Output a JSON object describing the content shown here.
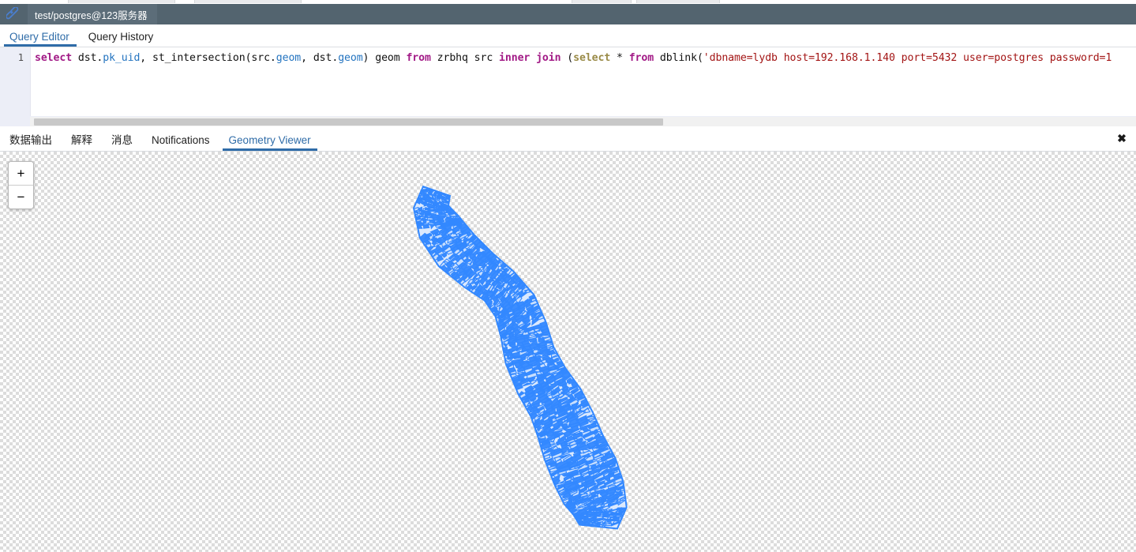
{
  "window": {
    "connection_icon": "link-icon",
    "connection_title": "test/postgres@123服务器"
  },
  "editor_tabs": [
    {
      "label": "Query Editor",
      "active": true
    },
    {
      "label": "Query History",
      "active": false
    }
  ],
  "editor": {
    "line_number": "1",
    "query_tokens": [
      {
        "t": "select",
        "c": "kw"
      },
      {
        "t": " dst.",
        "c": "plain"
      },
      {
        "t": "pk_uid",
        "c": "col"
      },
      {
        "t": ", st_intersection(src.",
        "c": "plain"
      },
      {
        "t": "geom",
        "c": "col"
      },
      {
        "t": ", dst.",
        "c": "plain"
      },
      {
        "t": "geom",
        "c": "col"
      },
      {
        "t": ") geom ",
        "c": "plain"
      },
      {
        "t": "from",
        "c": "kw"
      },
      {
        "t": " zrbhq src ",
        "c": "plain"
      },
      {
        "t": "inner join",
        "c": "kw"
      },
      {
        "t": " (",
        "c": "plain"
      },
      {
        "t": "select",
        "c": "kw2"
      },
      {
        "t": " * ",
        "c": "plain"
      },
      {
        "t": "from",
        "c": "kw"
      },
      {
        "t": " dblink(",
        "c": "plain"
      },
      {
        "t": "'dbname=lydb host=192.168.1.140 port=5432 user=postgres password=1",
        "c": "str"
      }
    ],
    "query_text": "select dst.pk_uid, st_intersection(src.geom, dst.geom) geom from zrbhq src inner join (select * from dblink('dbname=lydb host=192.168.1.140 port=5432 user=postgres password=1"
  },
  "output_tabs": [
    {
      "label": "数据输出",
      "active": false
    },
    {
      "label": "解释",
      "active": false
    },
    {
      "label": "消息",
      "active": false
    },
    {
      "label": "Notifications",
      "active": false
    },
    {
      "label": "Geometry Viewer",
      "active": true
    }
  ],
  "output_panel": {
    "close_label": "✖"
  },
  "geometry_viewer": {
    "zoom_in_label": "+",
    "zoom_out_label": "−",
    "fill_color": "#3388ff",
    "stroke_color": "#3388ff",
    "background": "transparent-checkerboard"
  }
}
